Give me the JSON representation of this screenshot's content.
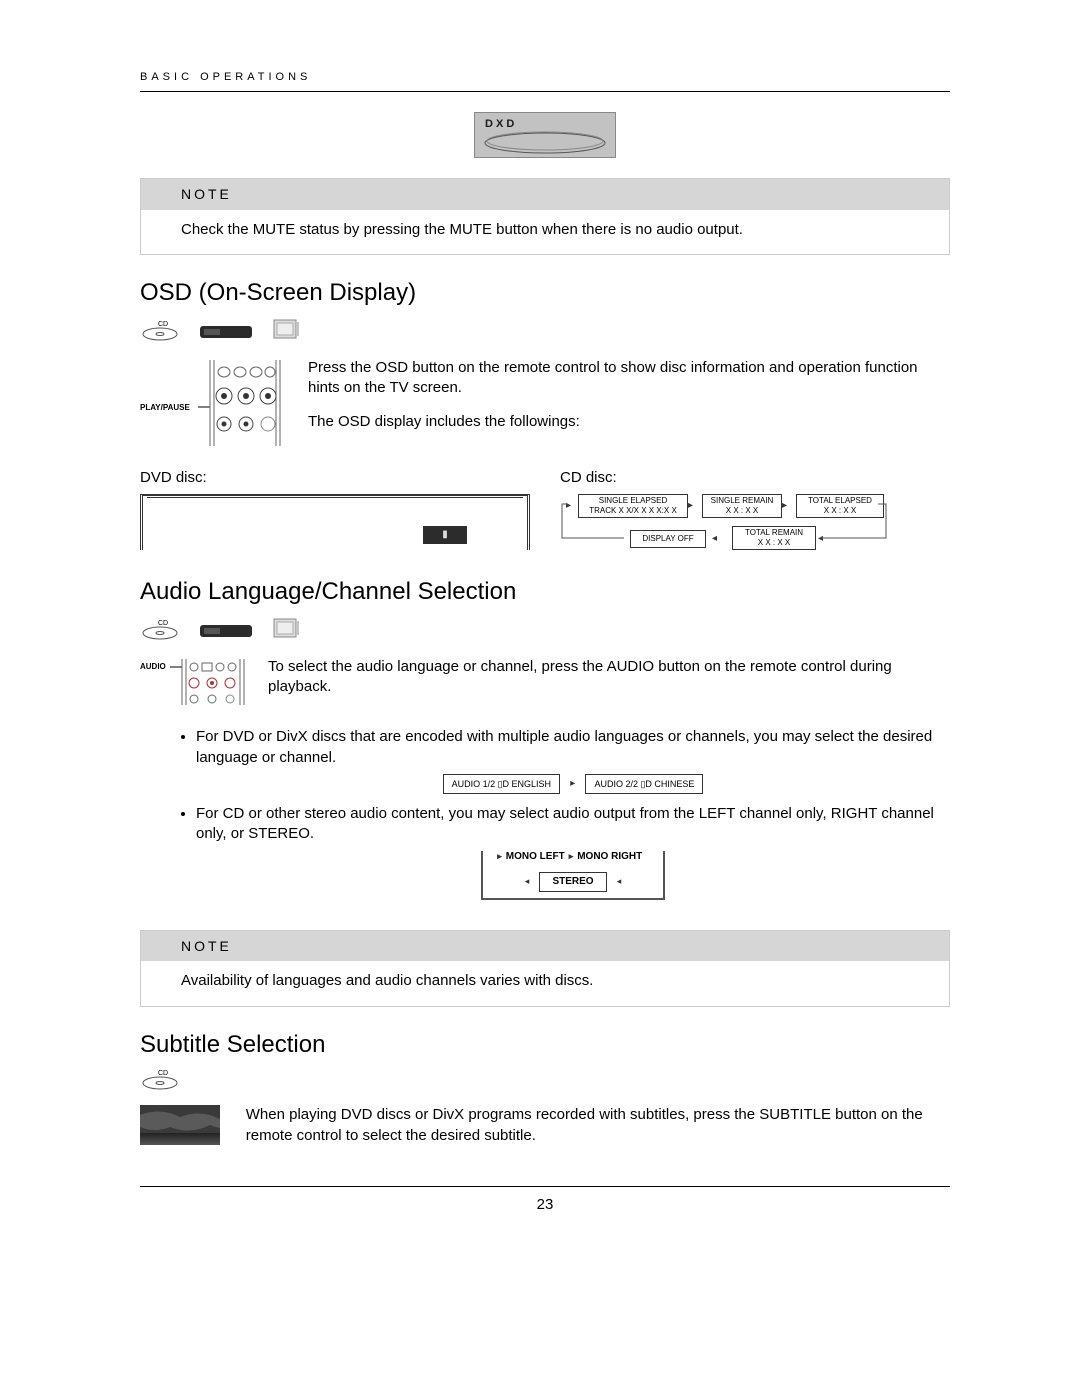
{
  "header": "BASIC OPERATIONS",
  "note1": {
    "label": "NOTE",
    "body": "Check the MUTE status by pressing the MUTE button when there is no audio output."
  },
  "osd": {
    "heading": "OSD (On-Screen Display)",
    "cd_label": "CD",
    "remote_label": "PLAY/PAUSE",
    "para1": "Press the OSD button on the remote control to show disc information and operation function hints on the TV screen.",
    "para2": "The OSD display includes the followings:",
    "dvd_label": "DVD disc:",
    "cd_disc_label": "CD disc:",
    "cd_chips": {
      "single_elapsed_line1": "SINGLE ELAPSED",
      "single_elapsed_line2": "TRACK X X/X X  X X:X X",
      "single_remain_line1": "SINGLE REMAIN",
      "single_remain_line2": "X X : X X",
      "total_elapsed_line1": "TOTAL ELAPSED",
      "total_elapsed_line2": "X X : X X",
      "display_off": "DISPLAY OFF",
      "total_remain_line1": "TOTAL REMAIN",
      "total_remain_line2": "X X : X X"
    }
  },
  "audio": {
    "heading": "Audio Language/Channel Selection",
    "cd_label": "CD",
    "remote_label": "AUDIO",
    "intro": "To select the audio language or channel, press the AUDIO button on the remote control during playback.",
    "bullet1": "For DVD or DivX discs that are encoded with multiple audio languages or channels, you may select the desired language or channel.",
    "chip1": "AUDIO  1/2  ▯D  ENGLISH",
    "chip2": "AUDIO  2/2  ▯D  CHINESE",
    "bullet2": "For CD or other stereo audio content, you may select audio output from the LEFT channel only, RIGHT channel only, or STEREO.",
    "mono_left": "MONO LEFT",
    "mono_right": "MONO RIGHT",
    "stereo": "STEREO"
  },
  "note2": {
    "label": "NOTE",
    "body": "Availability of languages and audio channels varies with discs."
  },
  "subtitle": {
    "heading": "Subtitle Selection",
    "cd_label": "CD",
    "body": "When playing DVD discs or DivX programs recorded with subtitles, press the SUBTITLE button on the remote control to select the desired subtitle."
  },
  "page_number": "23"
}
